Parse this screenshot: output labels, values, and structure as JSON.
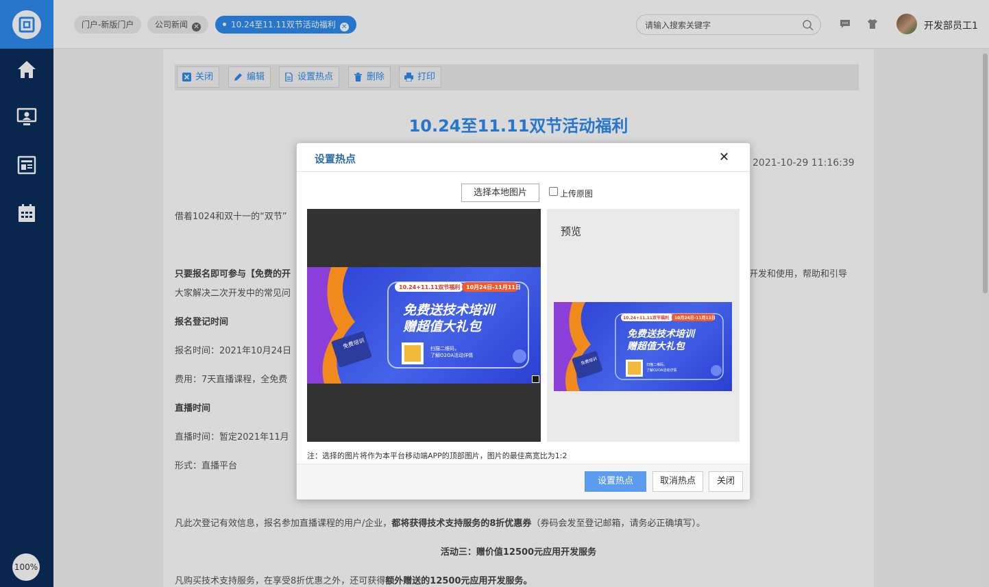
{
  "sidebar": {
    "items": [
      "home-icon",
      "monitor-user-icon",
      "news-icon",
      "calendar-icon"
    ],
    "zoom": "100%",
    "colors": {
      "bg": "#0b2d5b",
      "logo_bg": "#2d8cf0"
    }
  },
  "header": {
    "tabs": [
      {
        "label": "门户-新版门户",
        "closable": false,
        "active": false
      },
      {
        "label": "公司新闻",
        "closable": true,
        "active": false
      },
      {
        "label": "10.24至11.11双节活动福利",
        "closable": true,
        "active": true
      }
    ],
    "search_placeholder": "请输入搜索关键字",
    "username": "开发部员工1"
  },
  "toolbar": {
    "buttons": [
      {
        "label": "关闭",
        "icon": "close-square-icon"
      },
      {
        "label": "编辑",
        "icon": "pencil-icon"
      },
      {
        "label": "设置热点",
        "icon": "document-icon"
      },
      {
        "label": "删除",
        "icon": "trash-icon"
      },
      {
        "label": "打印",
        "icon": "printer-icon"
      }
    ]
  },
  "document": {
    "title": "10.24至11.11双节活动福利",
    "date": "2021-10-29 11:16:39",
    "intro": "借着1024和双十一的“双节”",
    "para2_a": "只要报名即可参与【免费的开",
    "para2_b": "开发和使用，帮助和引导",
    "para2_c": "大家解决二次开发中的常见问",
    "reg_heading": "报名登记时间",
    "reg_time": "报名时间：2021年10月24日",
    "fee": "费用：7天直播课程，全免费",
    "live_heading": "直播时间",
    "live_time": "直播时间：暂定2021年11月",
    "format": "形式：直播平台",
    "coupon_a": "凡此次登记有效信息，报名参加直播课程的用户/企业，",
    "coupon_b": "都将获得技术支持服务的8折优惠券",
    "coupon_c": "（券码会发至登记邮箱，请务必正确填写）。",
    "activity3": "活动三：赠价值12500元应用开发服务",
    "last_a": "凡购买技术支持服务，在享受8折优惠之外，还可获得",
    "last_b": "额外赠送的12500元应用开发服务。"
  },
  "modal": {
    "title": "设置热点",
    "pick_button": "选择本地图片",
    "upload_original": "上传原图",
    "preview_label": "预览",
    "note": "注：选择的图片将作为本平台移动端APP的顶部图片，图片的最佳高宽比为1:2",
    "buttons": {
      "set": "设置热点",
      "cancel": "取消热点",
      "close": "关闭"
    },
    "banner": {
      "tag_left": "10.24+11.11双节福利",
      "tag_right": "10月24日-11月11日",
      "headline1": "免费送技术培训",
      "headline2": "赠超值大礼包",
      "qr_text1": "扫描二维码，",
      "qr_text2": "了解O2OA活动详情",
      "screen_text": "免费培训"
    }
  },
  "colors": {
    "accent": "#2d8cf0",
    "title": "#2d6aa8",
    "primary_btn": "#5b9cf0"
  }
}
